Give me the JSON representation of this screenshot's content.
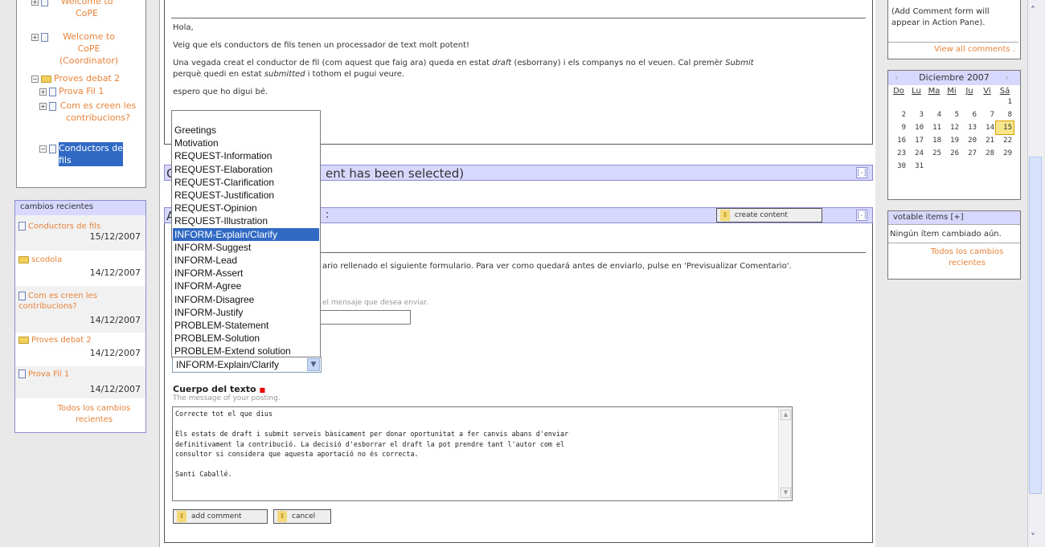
{
  "tree": {
    "items": [
      {
        "label": "Welcome to CoPE",
        "indent": 0
      },
      {
        "label": "Welcome to CoPE (Coordinator)",
        "indent": 0
      },
      {
        "label": "Proves debat 2",
        "indent": 0
      },
      {
        "label": "Prova Fil 1",
        "indent": 1
      },
      {
        "label": "Com es creen les contribucions?",
        "indent": 1
      },
      {
        "label": "Conductors de fils",
        "indent": 1
      }
    ]
  },
  "recent": {
    "title": "cambios recientes",
    "items": [
      {
        "title": "Conductors de fils",
        "date": "15/12/2007",
        "type": "doc"
      },
      {
        "title": "scodola",
        "date": "14/12/2007",
        "type": "folder"
      },
      {
        "title": "Com es creen les contribucions?",
        "date": "14/12/2007",
        "type": "doc"
      },
      {
        "title": "Proves debat 2",
        "date": "14/12/2007",
        "type": "folder"
      },
      {
        "title": "Prova Fil 1",
        "date": "14/12/2007",
        "type": "doc"
      }
    ],
    "all_link": "Todos los cambios recientes"
  },
  "message": {
    "greeting": "Hola,",
    "p1": "Veig que els conductors de fils tenen un processador de text molt potent!",
    "p2a": "Una vegada creat el conductor de fil (com aquest que faig ara) queda en estat ",
    "p2b": "draft",
    "p2c": " (esborrany) i els companys no el veuen. Cal premèr ",
    "p2d": "Submit",
    "p2e": "perquè quedi en estat ",
    "p2f": "submitted",
    "p2g": " i tothom el pugui veure.",
    "p3": "espero que ho digui bé."
  },
  "bar1": {
    "text": "C",
    "text2": "ent has been selected)",
    "collapse": "[-]"
  },
  "bar2": {
    "text": "A",
    "text2": ":",
    "create_button": "create content",
    "collapse": "[-]"
  },
  "form": {
    "instructions": "ario rellenado el siguiente formulario. Para ver como quedará antes de enviarlo, pulse en 'Previsualizar Comentario'.",
    "subject_hint": "el mensaje que desea enviar.",
    "select_value": "INFORM-Explain/Clarify",
    "body_label": "Cuerpo del texto",
    "body_required": "■",
    "body_hint": "The message of your posting.",
    "body_text": "Correcte tot el que dius\n\nEls estats de draft i submit serveis bàsicament per donar oportunitat a fer canvis abans d'enviar\ndefinitivament la contribució. La decisió d'esborrar el draft la pot prendre tant l'autor com el\nconsultor si considera que aquesta aportació no és correcta.\n\nSanti Caballé.",
    "add_button": "add comment",
    "cancel_button": "cancel"
  },
  "dropdown": {
    "options": [
      "Greetings",
      "Motivation",
      "REQUEST-Information",
      "REQUEST-Elaboration",
      "REQUEST-Clarification",
      "REQUEST-Justification",
      "REQUEST-Opinion",
      "REQUEST-Illustration",
      "INFORM-Explain/Clarify",
      "INFORM-Suggest",
      "INFORM-Lead",
      "INFORM-Assert",
      "INFORM-Agree",
      "INFORM-Disagree",
      "INFORM-Justify",
      "PROBLEM-Statement",
      "PROBLEM-Solution",
      "PROBLEM-Extend solution"
    ],
    "selected_index": 8
  },
  "comments": {
    "note": "(Add Comment form will appear in Action Pane).",
    "view_all": "View all comments ."
  },
  "calendar": {
    "month": "Diciembre 2007",
    "prev": "‹",
    "next": "›",
    "weekdays": [
      "Do",
      "Lu",
      "Ma",
      "Mi",
      "Ju",
      "Vi",
      "Sá"
    ],
    "weeks": [
      [
        "",
        "",
        "",
        "",
        "",
        "",
        "1"
      ],
      [
        "2",
        "3",
        "4",
        "5",
        "6",
        "7",
        "8"
      ],
      [
        "9",
        "10",
        "11",
        "12",
        "13",
        "14",
        "15"
      ],
      [
        "16",
        "17",
        "18",
        "19",
        "20",
        "21",
        "22"
      ],
      [
        "23",
        "24",
        "25",
        "26",
        "27",
        "28",
        "29"
      ],
      [
        "30",
        "31",
        "",
        "",
        "",
        "",
        ""
      ]
    ],
    "today": "15"
  },
  "votable": {
    "title": "votable items [+]",
    "empty": "Ningún ítem cambiado aún.",
    "all_link": "Todos los cambios recientes"
  },
  "scroll": {
    "up": "˄",
    "down": "˅"
  }
}
